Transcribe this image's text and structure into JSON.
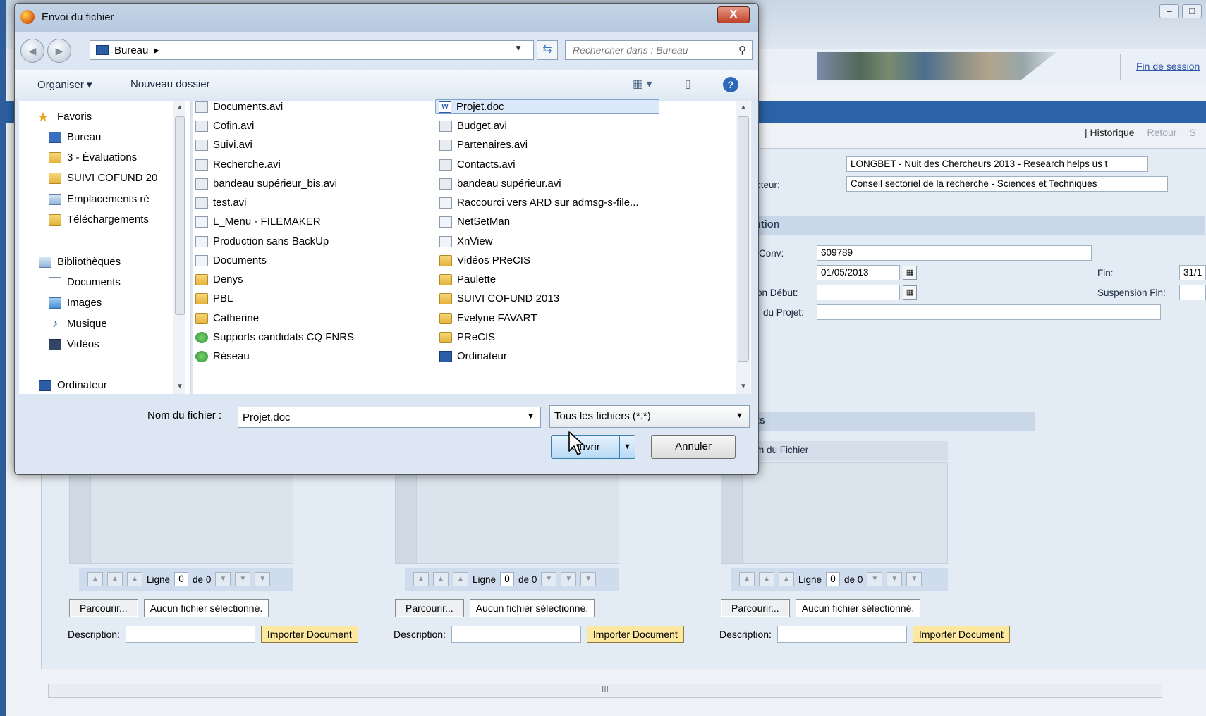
{
  "background": {
    "logout_link": "Fin de session",
    "nav": {
      "historique": "| Historique",
      "retour": "Retour",
      "s": "S"
    },
    "project_title": "LONGBET - Nuit des Chercheurs 2013 - Research helps us t",
    "secteur_label": "cteur:",
    "secteur_value": "Conseil sectoriel de la recherche - Sciences et Techniques",
    "section_convention": "ntion",
    "conv_label": "Conv:",
    "conv_value": "609789",
    "debut_value": "01/05/2013",
    "fin_label": "Fin:",
    "fin_value": "31/1",
    "suspension_debut_label": "ion Début:",
    "suspension_fin_label": "Suspension Fin:",
    "projet_label": "du Projet:",
    "section_documents": "ts",
    "column_fichier": "m du Fichier",
    "uploaders": [
      {
        "ligne": "Ligne",
        "value": "0",
        "de": "de 0",
        "browse": "Parcourir...",
        "nofile": "Aucun fichier sélectionné.",
        "desc": "Description:",
        "import": "Importer Document"
      },
      {
        "ligne": "Ligne",
        "value": "0",
        "de": "de 0",
        "browse": "Parcourir...",
        "nofile": "Aucun fichier sélectionné.",
        "desc": "Description:",
        "import": "Importer Document"
      },
      {
        "ligne": "Ligne",
        "value": "0",
        "de": "de 0",
        "browse": "Parcourir...",
        "nofile": "Aucun fichier sélectionné.",
        "desc": "Description:",
        "import": "Importer Document"
      }
    ],
    "hscroll_grip": "III",
    "window_buttons": [
      "–",
      "□"
    ]
  },
  "dialog": {
    "title": "Envoi du fichier",
    "close": "X",
    "address": "Bureau",
    "address_arrow": "▸",
    "search_placeholder": "Rechercher dans : Bureau",
    "toolbar": {
      "organiser": "Organiser ▾",
      "nouveau_dossier": "Nouveau dossier",
      "help": "?"
    },
    "nav_items": [
      {
        "label": "Favoris",
        "icon": "star-icon"
      },
      {
        "label": "Bureau",
        "icon": "desktop-icon"
      },
      {
        "label": "3 - Évaluations",
        "icon": "folder-icon"
      },
      {
        "label": "SUIVI COFUND 20",
        "icon": "folder-icon"
      },
      {
        "label": "Emplacements ré",
        "icon": "recent-places-icon"
      },
      {
        "label": "Téléchargements",
        "icon": "downloads-icon"
      },
      {
        "label": "Bibliothèques",
        "icon": "libraries-icon"
      },
      {
        "label": "Documents",
        "icon": "documents-icon"
      },
      {
        "label": "Images",
        "icon": "pictures-icon"
      },
      {
        "label": "Musique",
        "icon": "music-icon"
      },
      {
        "label": "Vidéos",
        "icon": "videos-icon"
      },
      {
        "label": "Ordinateur",
        "icon": "computer-icon"
      }
    ],
    "files_col1": [
      {
        "label": "Documents.avi",
        "icon": "avi"
      },
      {
        "label": "Cofin.avi",
        "icon": "avi"
      },
      {
        "label": "Suivi.avi",
        "icon": "avi"
      },
      {
        "label": "Recherche.avi",
        "icon": "avi"
      },
      {
        "label": "bandeau supérieur_bis.avi",
        "icon": "avi"
      },
      {
        "label": "test.avi",
        "icon": "avi"
      },
      {
        "label": "L_Menu - FILEMAKER",
        "icon": "lnk"
      },
      {
        "label": "Production sans BackUp",
        "icon": "lnk"
      },
      {
        "label": "Documents",
        "icon": "lnk"
      },
      {
        "label": "Denys",
        "icon": "folder"
      },
      {
        "label": "PBL",
        "icon": "folder"
      },
      {
        "label": "Catherine",
        "icon": "folder"
      },
      {
        "label": "Supports candidats CQ FNRS",
        "icon": "net"
      },
      {
        "label": "Réseau",
        "icon": "net"
      }
    ],
    "files_col2": [
      {
        "label": "Projet.doc",
        "icon": "word"
      },
      {
        "label": "Budget.avi",
        "icon": "avi"
      },
      {
        "label": "Partenaires.avi",
        "icon": "avi"
      },
      {
        "label": "Contacts.avi",
        "icon": "avi"
      },
      {
        "label": "bandeau supérieur.avi",
        "icon": "avi"
      },
      {
        "label": "Raccourci vers ARD sur admsg-s-file...",
        "icon": "lnk"
      },
      {
        "label": "NetSetMan",
        "icon": "lnk"
      },
      {
        "label": "XnView",
        "icon": "lnk"
      },
      {
        "label": "Vidéos PReCIS",
        "icon": "folder"
      },
      {
        "label": "Paulette",
        "icon": "folder"
      },
      {
        "label": "SUIVI COFUND 2013",
        "icon": "folder"
      },
      {
        "label": "Evelyne FAVART",
        "icon": "folder"
      },
      {
        "label": "PReCIS",
        "icon": "folder"
      },
      {
        "label": "Ordinateur",
        "icon": "pc"
      }
    ],
    "filename_label": "Nom du fichier :",
    "filename_value": "Projet.doc",
    "filetype": "Tous les fichiers (*.*)",
    "open_label": "Ouvrir",
    "cancel_label": "Annuler"
  }
}
